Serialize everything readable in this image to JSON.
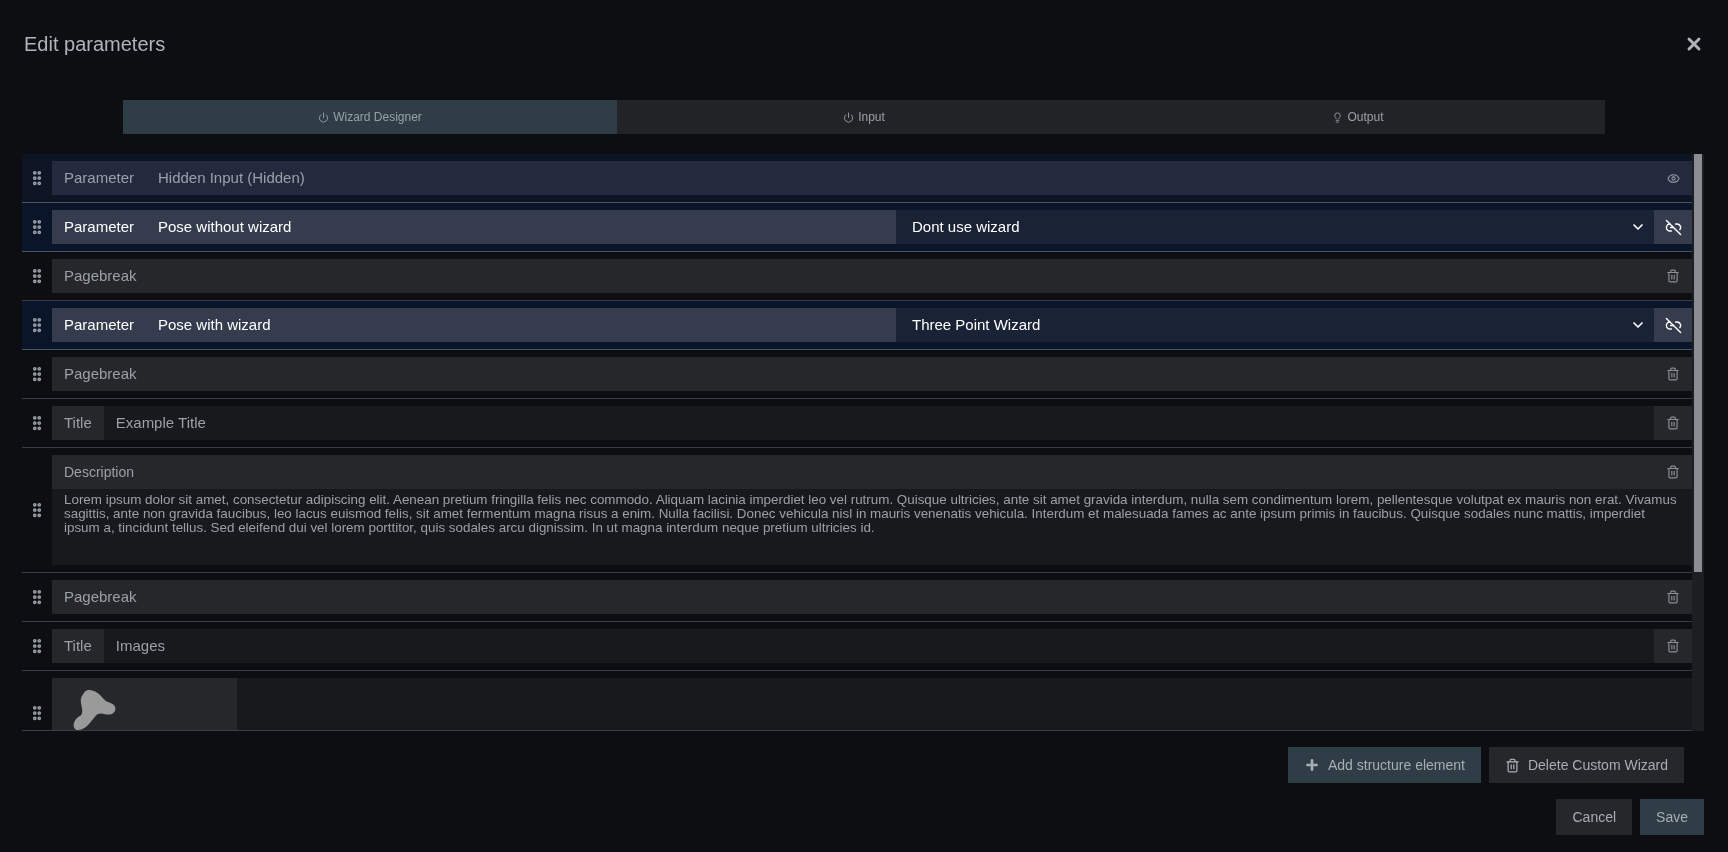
{
  "dialog": {
    "title": "Edit parameters"
  },
  "tabs": [
    {
      "label": "Wizard Designer",
      "selected": true
    },
    {
      "label": "Input",
      "selected": false
    },
    {
      "label": "Output",
      "selected": false
    }
  ],
  "elements": [
    {
      "kind": "parameter",
      "label": "Parameter",
      "name": "Hidden Input (Hidden)",
      "hidden": true
    },
    {
      "kind": "parameter",
      "label": "Parameter",
      "name": "Pose without wizard",
      "hidden": false,
      "wizard": "Dont use wizard"
    },
    {
      "kind": "pagebreak",
      "label": "Pagebreak"
    },
    {
      "kind": "parameter",
      "label": "Parameter",
      "name": "Pose with wizard",
      "hidden": false,
      "wizard": "Three Point Wizard"
    },
    {
      "kind": "pagebreak",
      "label": "Pagebreak"
    },
    {
      "kind": "title",
      "label": "Title",
      "value": "Example Title"
    },
    {
      "kind": "description",
      "label": "Description",
      "value": "Lorem ipsum dolor sit amet, consectetur adipiscing elit. Aenean pretium fringilla felis nec commodo. Aliquam lacinia imperdiet leo vel rutrum. Quisque ultricies, ante sit amet gravida interdum, nulla sem condimentum lorem, pellentesque volutpat ex mauris non erat. Vivamus sagittis, ante non gravida faucibus, leo lacus euismod felis, sit amet fermentum magna risus a enim. Nulla facilisi. Donec vehicula nisl in mauris venenatis vehicula. Interdum et malesuada fames ac ante ipsum primis in faucibus. Quisque sodales nunc mattis, imperdiet ipsum a, tincidunt tellus. Sed eleifend dui vel lorem porttitor, quis sodales arcu dignissim. In ut magna interdum neque pretium ultricies id."
    },
    {
      "kind": "pagebreak",
      "label": "Pagebreak"
    },
    {
      "kind": "title",
      "label": "Title",
      "value": "Images"
    },
    {
      "kind": "image"
    }
  ],
  "actions": [
    "Add structure element",
    "Delete Custom Wizard"
  ],
  "footer": [
    "Cancel",
    "Save"
  ]
}
